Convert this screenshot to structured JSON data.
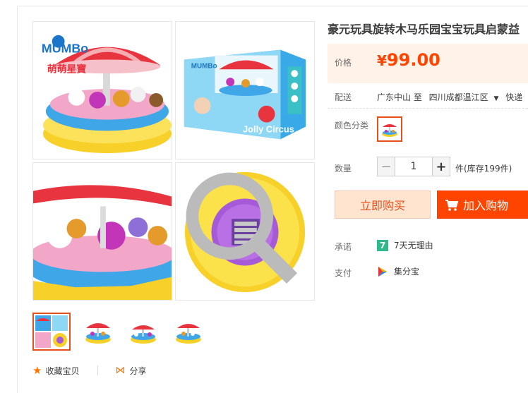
{
  "product": {
    "title": "豪元玩具旋转木马乐园宝宝玩具启蒙益",
    "price_label": "价格",
    "currency": "¥",
    "price": "99.00"
  },
  "shipping": {
    "label": "配送",
    "from": "广东中山 至",
    "to": "四川成都温江区",
    "method": "快递"
  },
  "color": {
    "label": "颜色分类"
  },
  "quantity": {
    "label": "数量",
    "value": "1",
    "minus": "−",
    "plus": "+",
    "stock": "件(库存199件)"
  },
  "actions": {
    "buy_now": "立即购买",
    "add_to_cart": "加入购物"
  },
  "promise": {
    "label": "承诺",
    "badge": "7",
    "text": "7天无理由"
  },
  "payment": {
    "label": "支付",
    "text": "集分宝"
  },
  "gallery": {
    "brand_logo": "MUMBo",
    "brand_sub": "萌萌星寶",
    "box_text": "Jolly Circus",
    "box_brand": "MUMBo"
  },
  "footer": {
    "favorite": "收藏宝贝",
    "share": "分享"
  },
  "colors": {
    "price": "#ff4400",
    "accent_border": "#e4501a",
    "buy_now_bg": "#ffe4d0",
    "cart_bg": "#ff4400",
    "promise_badge": "#2fba8c"
  }
}
